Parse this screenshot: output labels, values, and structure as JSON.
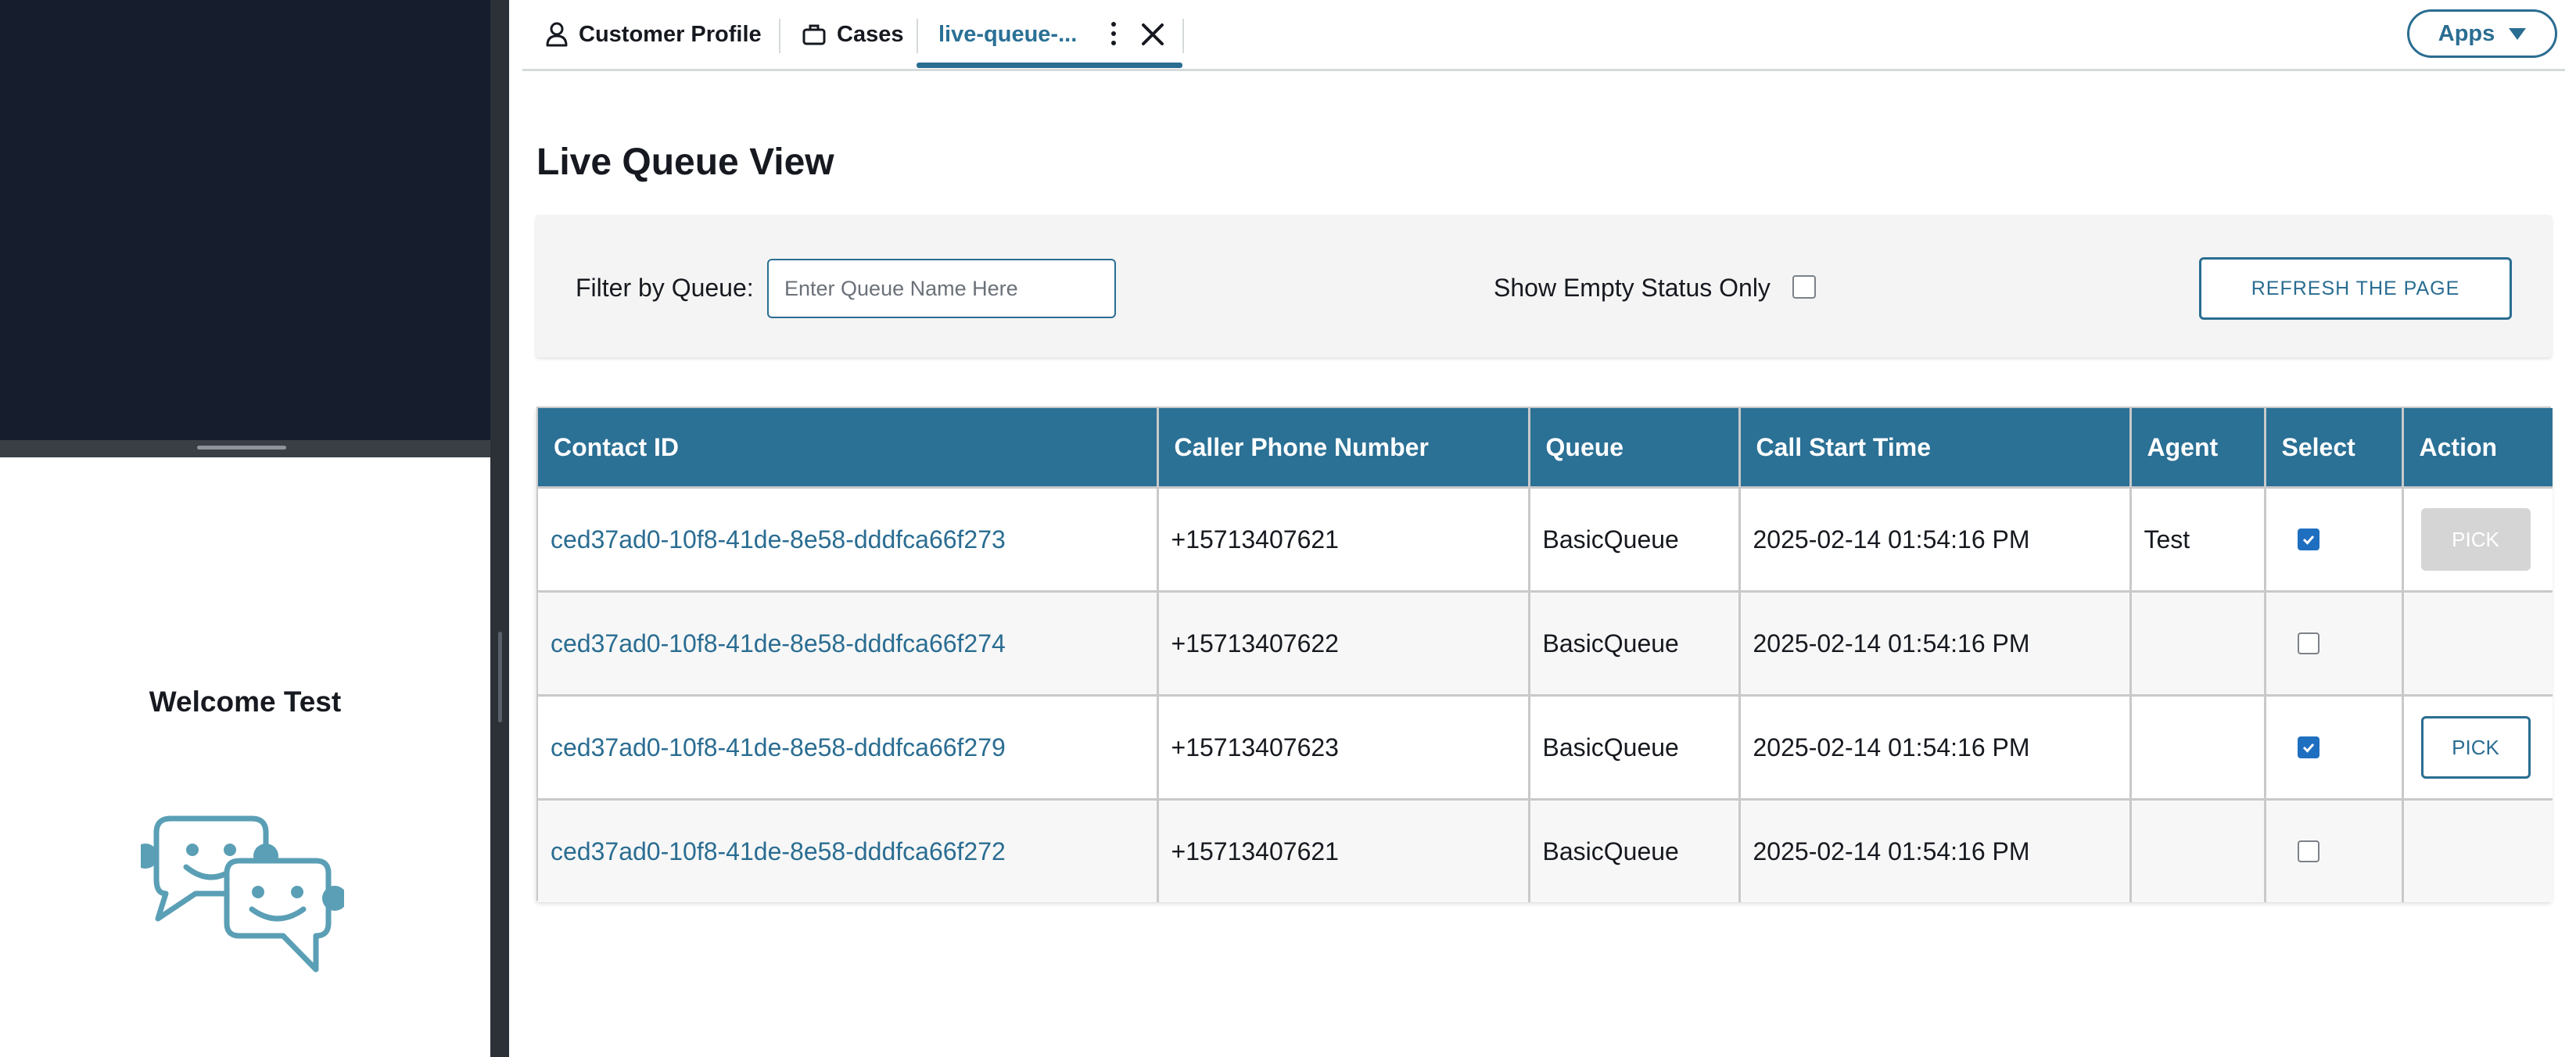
{
  "left_panel": {
    "welcome_text": "Welcome Test"
  },
  "tabs": [
    {
      "label": "Customer Profile",
      "icon": "user-icon"
    },
    {
      "label": "Cases",
      "icon": "briefcase-icon"
    },
    {
      "label": "live-queue-...",
      "active": true
    }
  ],
  "apps_button": {
    "label": "Apps"
  },
  "page": {
    "title": "Live Queue View"
  },
  "filter": {
    "label": "Filter by Queue:",
    "placeholder": "Enter Queue Name Here",
    "value": "",
    "empty_label": "Show Empty Status Only",
    "empty_checked": false,
    "refresh_label": "REFRESH THE PAGE"
  },
  "table": {
    "columns": [
      "Contact ID",
      "Caller Phone Number",
      "Queue",
      "Call Start Time",
      "Agent",
      "Select",
      "Action"
    ],
    "rows": [
      {
        "contact_id": "ced37ad0-10f8-41de-8e58-dddfca66f273",
        "phone": "+15713407621",
        "queue": "BasicQueue",
        "start": "2025-02-14 01:54:16 PM",
        "agent": "Test",
        "selected": true,
        "action": "PICK",
        "action_enabled": false
      },
      {
        "contact_id": "ced37ad0-10f8-41de-8e58-dddfca66f274",
        "phone": "+15713407622",
        "queue": "BasicQueue",
        "start": "2025-02-14 01:54:16 PM",
        "agent": "",
        "selected": false,
        "action": "",
        "action_enabled": false
      },
      {
        "contact_id": "ced37ad0-10f8-41de-8e58-dddfca66f279",
        "phone": "+15713407623",
        "queue": "BasicQueue",
        "start": "2025-02-14 01:54:16 PM",
        "agent": "",
        "selected": true,
        "action": "PICK",
        "action_enabled": true
      },
      {
        "contact_id": "ced37ad0-10f8-41de-8e58-dddfca66f272",
        "phone": "+15713407621",
        "queue": "BasicQueue",
        "start": "2025-02-14 01:54:16 PM",
        "agent": "",
        "selected": false,
        "action": "",
        "action_enabled": false
      }
    ]
  },
  "colors": {
    "header_bg": "#2b7095",
    "accent": "#2a6d92",
    "left_dark": "#161e2d"
  }
}
